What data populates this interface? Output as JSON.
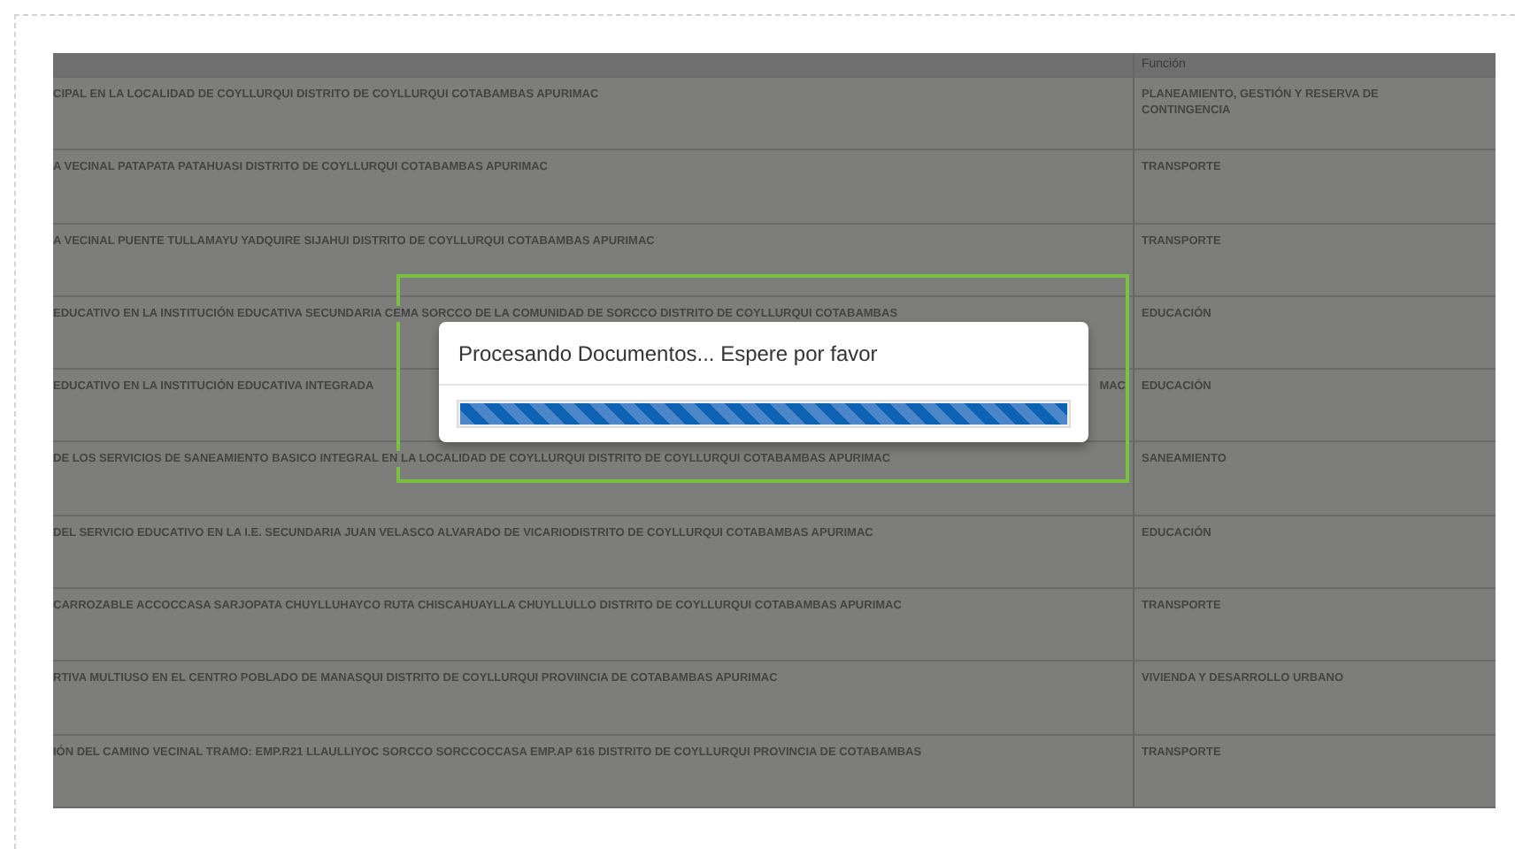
{
  "table": {
    "columns": [
      {
        "label": "Función"
      }
    ],
    "rows": [
      {
        "description": "CIPAL EN LA LOCALIDAD DE COYLLURQUI DISTRITO DE COYLLURQUI COTABAMBAS APURIMAC",
        "function": "PLANEAMIENTO, GESTIÓN Y RESERVA DE CONTINGENCIA"
      },
      {
        "description": "A VECINAL PATAPATA PATAHUASI DISTRITO DE COYLLURQUI COTABAMBAS APURIMAC",
        "function": "TRANSPORTE"
      },
      {
        "description": "A VECINAL PUENTE TULLAMAYU YADQUIRE SIJAHUI DISTRITO DE COYLLURQUI COTABAMBAS APURIMAC",
        "function": "TRANSPORTE"
      },
      {
        "description": "EDUCATIVO EN LA INSTITUCIÓN EDUCATIVA SECUNDARIA CEMA SORCCO DE LA COMUNIDAD DE SORCCO DISTRITO DE COYLLURQUI COTABAMBAS",
        "function": "EDUCACIÓN"
      },
      {
        "description": "EDUCATIVO EN LA INSTITUCIÓN EDUCATIVA INTEGRADA",
        "description_end": "MAC",
        "function": "EDUCACIÓN"
      },
      {
        "description": "DE LOS SERVICIOS DE SANEAMIENTO BASICO INTEGRAL EN LA LOCALIDAD DE COYLLURQUI DISTRITO DE COYLLURQUI COTABAMBAS APURIMAC",
        "function": "SANEAMIENTO"
      },
      {
        "description": "DEL SERVICIO EDUCATIVO EN LA I.E. SECUNDARIA JUAN VELASCO ALVARADO DE VICARIODISTRITO DE COYLLURQUI COTABAMBAS APURIMAC",
        "function": "EDUCACIÓN"
      },
      {
        "description": "CARROZABLE ACCOCCASA SARJOPATA CHUYLLUHAYCO RUTA CHISCAHUAYLLA CHUYLLULLO DISTRITO DE COYLLURQUI COTABAMBAS APURIMAC",
        "function": "TRANSPORTE"
      },
      {
        "description": "RTIVA MULTIUSO EN EL CENTRO POBLADO DE MANASQUI DISTRITO DE COYLLURQUI PROVIINCIA DE COTABAMBAS APURIMAC",
        "function": "VIVIENDA Y DESARROLLO URBANO"
      },
      {
        "description": "IÓN DEL CAMINO VECINAL TRAMO: EMP.R21 LLAULLIYOC SORCCO SORCCOCCASA EMP.AP 616 DISTRITO DE COYLLURQUI PROVINCIA DE COTABAMBAS",
        "function": "TRANSPORTE"
      }
    ]
  },
  "dialog": {
    "message": "Procesando Documentos... Espere por favor",
    "progress": {
      "level": 1
    }
  }
}
